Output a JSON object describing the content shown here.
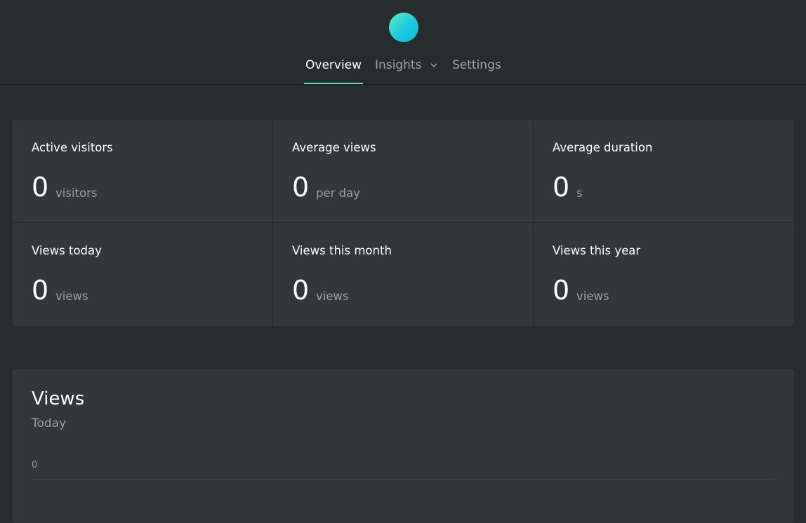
{
  "nav": {
    "tabs": [
      {
        "label": "Overview",
        "active": true
      },
      {
        "label": "Insights",
        "active": false,
        "icon": "chevron-down-icon"
      },
      {
        "label": "Settings",
        "active": false
      }
    ]
  },
  "colors": {
    "background": "#272c2d",
    "card": "#323839",
    "accent": "#5fe3c0",
    "logo_gradient_start": "#5ff0c3",
    "logo_gradient_end": "#0fbde0"
  },
  "stats": [
    {
      "label": "Active visitors",
      "value": "0",
      "unit": "visitors"
    },
    {
      "label": "Average views",
      "value": "0",
      "unit": "per day"
    },
    {
      "label": "Average duration",
      "value": "0",
      "unit": "s"
    },
    {
      "label": "Views today",
      "value": "0",
      "unit": "views"
    },
    {
      "label": "Views this month",
      "value": "0",
      "unit": "views"
    },
    {
      "label": "Views this year",
      "value": "0",
      "unit": "views"
    }
  ],
  "views": {
    "title": "Views",
    "subtitle": "Today"
  },
  "chart_data": {
    "type": "line",
    "title": "",
    "y_ticks": [
      "0"
    ],
    "series": [],
    "grid": true
  }
}
